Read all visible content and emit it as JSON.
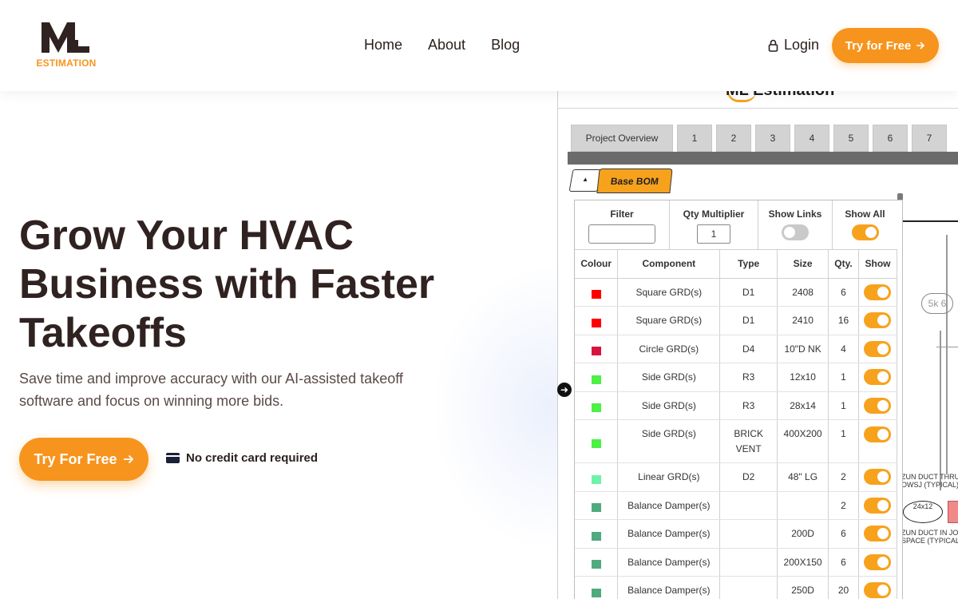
{
  "header": {
    "logo_mark": "ML",
    "logo_text": "ESTIMATION",
    "nav": [
      "Home",
      "About",
      "Blog"
    ],
    "login": "Login",
    "cta": "Try for Free"
  },
  "hero": {
    "title": "Grow Your HVAC Business with Faster Takeoffs",
    "subtitle": "Save time and improve accuracy with our AI-assisted takeoff software and focus on winning more bids.",
    "cta": "Try For Free",
    "note": "No credit card required"
  },
  "app": {
    "brand": "ML Estimation",
    "tabs": [
      "Project Overview",
      "1",
      "2",
      "3",
      "4",
      "5",
      "6",
      "7"
    ],
    "subtab": "Base BOM",
    "controls": {
      "filter_label": "Filter",
      "qty_label": "Qty Multiplier",
      "qty_value": "1",
      "links_label": "Show Links",
      "all_label": "Show All"
    },
    "columns": [
      "Colour",
      "Component",
      "Type",
      "Size",
      "Qty.",
      "Show"
    ],
    "rows": [
      {
        "colour": "#ff0000",
        "component": "Square GRD(s)",
        "type": "D1",
        "size": "2408",
        "qty": "6"
      },
      {
        "colour": "#ff0000",
        "component": "Square GRD(s)",
        "type": "D1",
        "size": "2410",
        "qty": "16"
      },
      {
        "colour": "#d8143c",
        "component": "Circle GRD(s)",
        "type": "D4",
        "size": "10\"D NK",
        "qty": "4"
      },
      {
        "colour": "#4cf046",
        "component": "Side GRD(s)",
        "type": "R3",
        "size": "12x10",
        "qty": "1"
      },
      {
        "colour": "#4cf046",
        "component": "Side GRD(s)",
        "type": "R3",
        "size": "28x14",
        "qty": "1"
      },
      {
        "colour": "#4cf046",
        "component": "Side GRD(s)",
        "type": "BRICK VENT",
        "size": "400X200",
        "qty": "1"
      },
      {
        "colour": "#6ef2a8",
        "component": "Linear GRD(s)",
        "type": "D2",
        "size": "48\" LG",
        "qty": "2"
      },
      {
        "colour": "#4faa7e",
        "component": "Balance Damper(s)",
        "type": "",
        "size": "",
        "qty": "2"
      },
      {
        "colour": "#4faa7e",
        "component": "Balance Damper(s)",
        "type": "",
        "size": "200D",
        "qty": "6"
      },
      {
        "colour": "#4faa7e",
        "component": "Balance Damper(s)",
        "type": "",
        "size": "200X150",
        "qty": "6"
      },
      {
        "colour": "#4faa7e",
        "component": "Balance Damper(s)",
        "type": "",
        "size": "250D",
        "qty": "20"
      }
    ],
    "drawing": {
      "note1": "ZUN DUCT THRU\nOWSJ (TYPICAL)",
      "note2": "ZUN DUCT IN JOI\nSPACE (TYPICAL)",
      "duct": "24x12",
      "tag": "5k 6"
    }
  },
  "colors": {
    "accent": "#f7941d",
    "text": "#2f2220"
  }
}
